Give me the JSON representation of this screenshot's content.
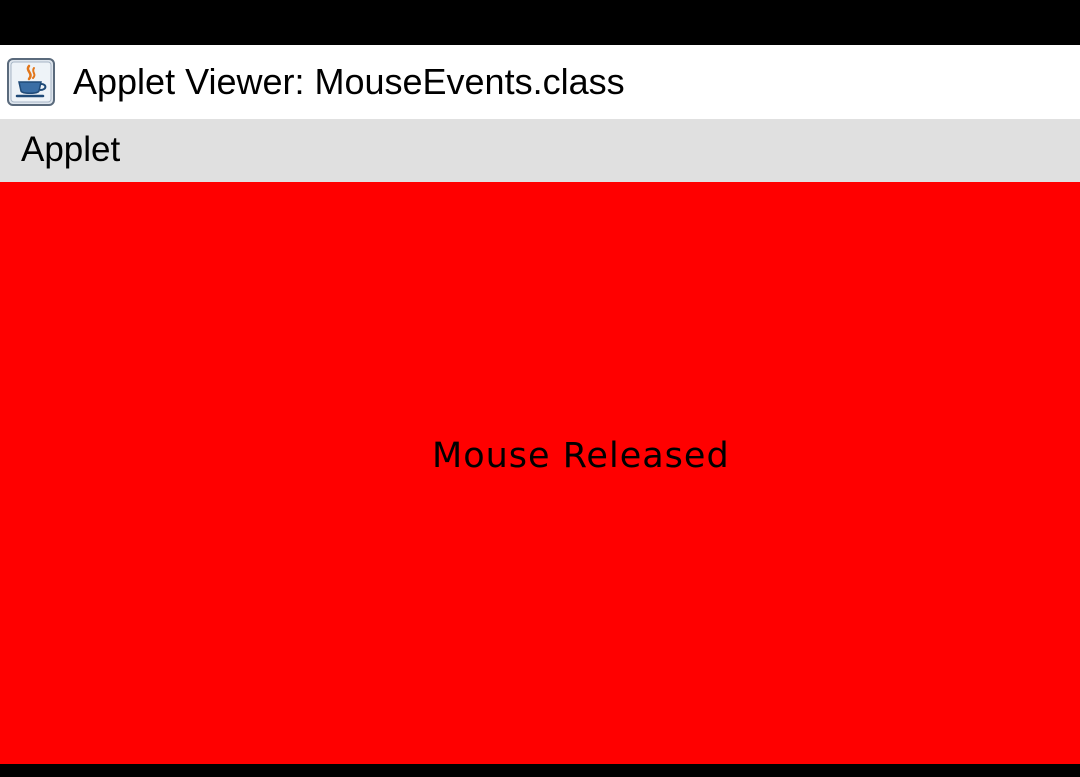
{
  "window": {
    "title": "Applet Viewer: MouseEvents.class",
    "icon": "java-cup-icon"
  },
  "menubar": {
    "items": [
      {
        "label": "Applet"
      }
    ]
  },
  "applet": {
    "message": "Mouse Released",
    "background_color": "#ff0000",
    "text_color": "#000000"
  },
  "colors": {
    "screen_border": "#000000",
    "titlebar": "#ffffff",
    "menubar": "#e0e0e0"
  }
}
